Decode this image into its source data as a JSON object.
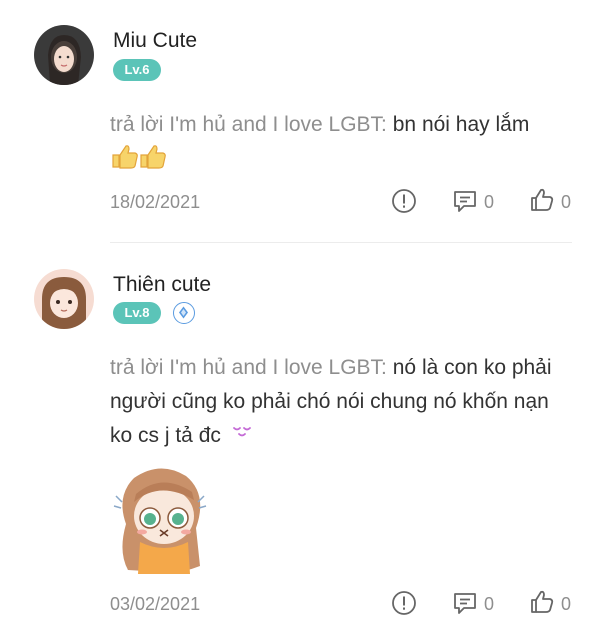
{
  "comments": [
    {
      "username": "Miu Cute",
      "level": "Lv.6",
      "reply_prefix": "trả lời I'm hủ and I love LGBT:",
      "content": "bn nói hay lắm",
      "emoji": "thumbs-up-icon x2",
      "date": "18/02/2021",
      "comment_count": "0",
      "like_count": "0",
      "colors": {
        "level_bg": "#5bc4b8"
      }
    },
    {
      "username": "Thiên cute",
      "level": "Lv.8",
      "reply_prefix": "trả lời I'm hủ and I love LGBT:",
      "content": "nó là con ko phải người cũng ko phải chó nói chung nó khốn nạn ko cs j tả đc",
      "emoji": "sleepy-face-icon",
      "sticker": "crying-anime-girl-sticker",
      "date": "03/02/2021",
      "comment_count": "0",
      "like_count": "0",
      "colors": {
        "level_bg": "#5bc4b8",
        "badge": "#5a9be0"
      }
    }
  ]
}
